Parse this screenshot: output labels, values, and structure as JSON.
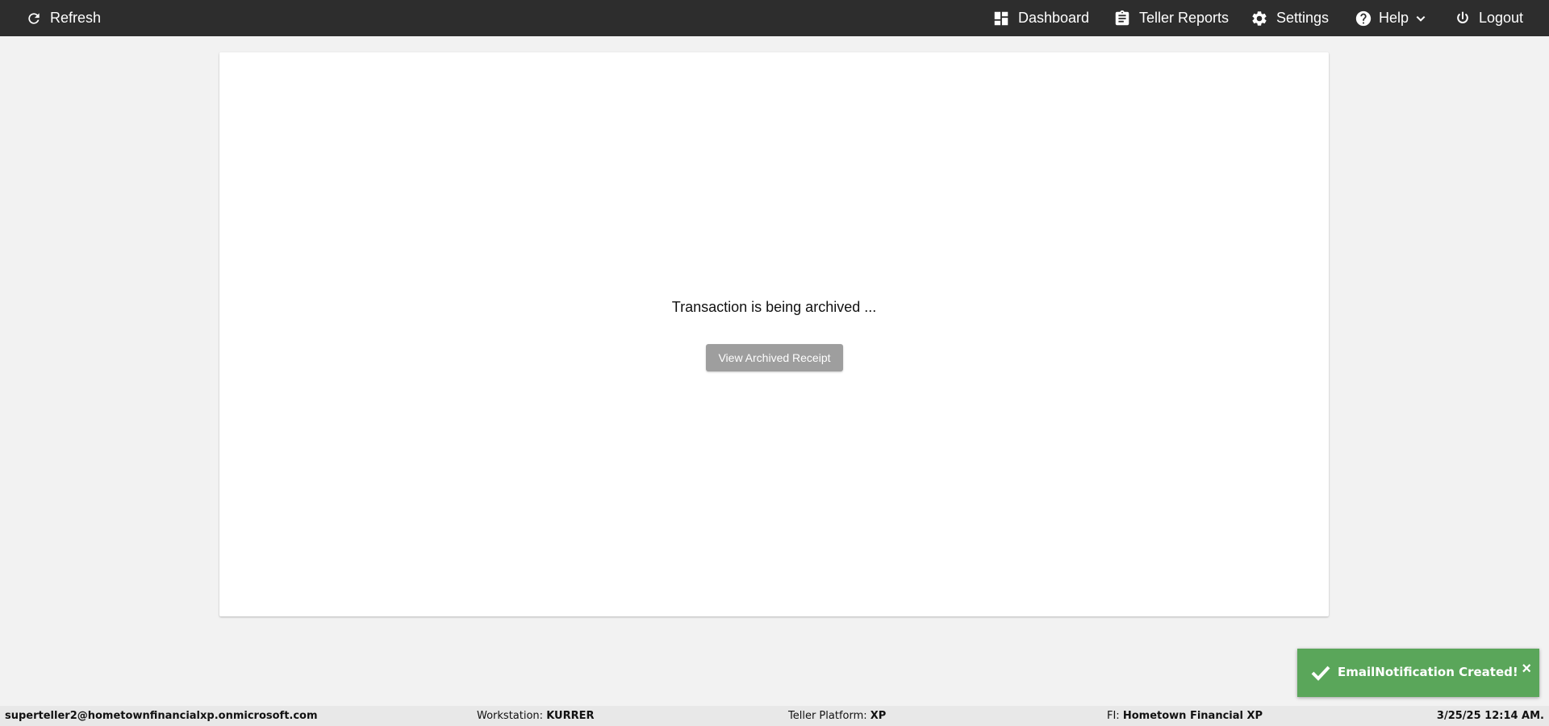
{
  "topbar": {
    "refresh_label": "Refresh",
    "nav": {
      "dashboard": "Dashboard",
      "teller_reports": "Teller Reports",
      "settings": "Settings",
      "help": "Help",
      "logout": "Logout"
    }
  },
  "main": {
    "status_message": "Transaction is being archived ...",
    "view_receipt_button": "View Archived Receipt"
  },
  "toast": {
    "message": "EmailNotification Created!",
    "close_glyph": "×",
    "color": "#5aa65a"
  },
  "footer": {
    "user_email": "superteller2@hometownfinancialxp.onmicrosoft.com",
    "workstation_label": "Workstation:",
    "workstation_value": "KURRER",
    "teller_platform_label": "Teller Platform:",
    "teller_platform_value": "XP",
    "fi_label": "FI:",
    "fi_value": "Hometown Financial XP",
    "datetime": "3/25/25 12:14 AM."
  },
  "colors": {
    "topbar_bg": "#2d2d2d",
    "page_bg": "#f2f2f2",
    "disabled_button": "#9e9e9e"
  }
}
